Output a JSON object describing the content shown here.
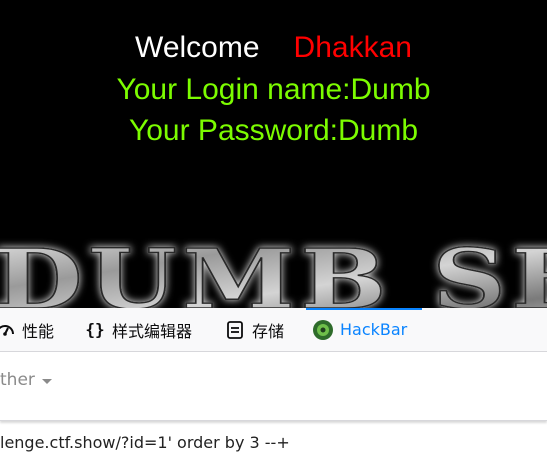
{
  "page": {
    "welcome_word": "Welcome",
    "username": "Dhakkan",
    "login_line": "Your Login name:Dumb",
    "password_line": "Your Password:Dumb",
    "banner_text": "DUMB SE",
    "colors": {
      "background": "#000000",
      "welcome": "#ffffff",
      "username": "#ff0000",
      "credentials": "#7cfc00"
    }
  },
  "devtools": {
    "tabs": [
      {
        "label": "性能",
        "icon": "performance-icon"
      },
      {
        "label": "样式编辑器",
        "icon": "braces-icon"
      },
      {
        "label": "存储",
        "icon": "storage-icon"
      },
      {
        "label": "HackBar",
        "icon": "hackbar-logo-icon",
        "selected": true
      }
    ],
    "other_menu": "ther",
    "url_value": "lenge.ctf.show/?id=1' order by 3 --+",
    "accent": "#0a84ff"
  }
}
